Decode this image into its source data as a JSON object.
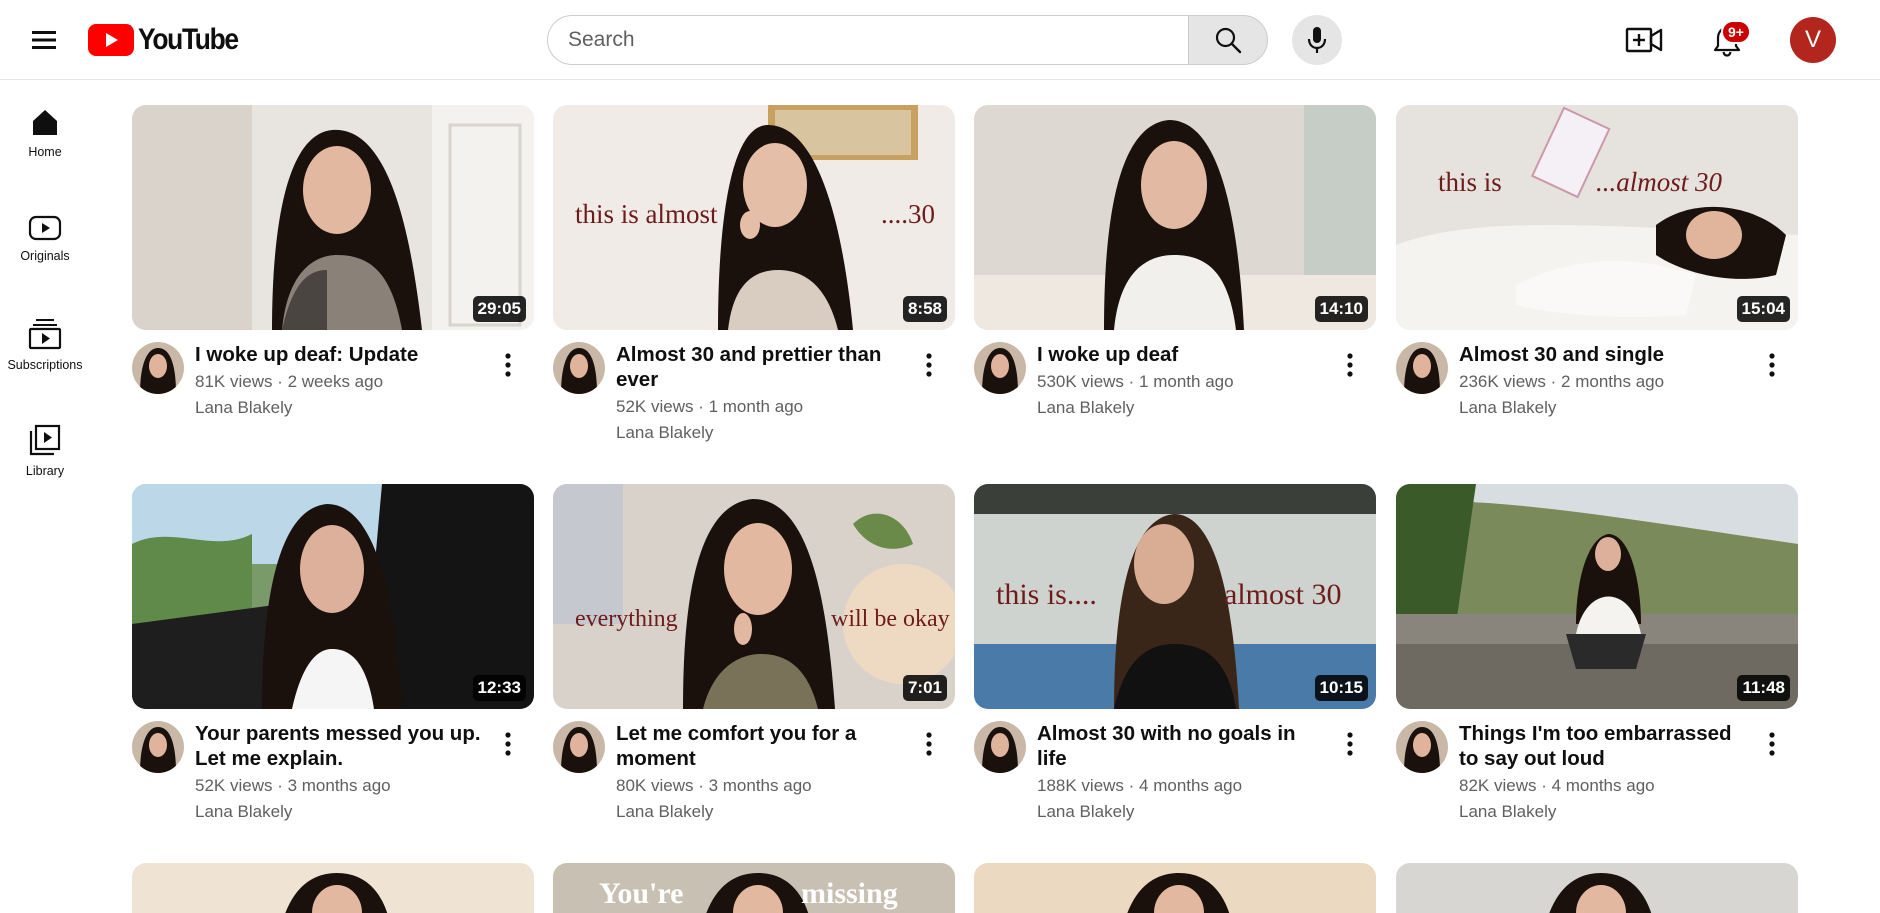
{
  "header": {
    "logo_text": "YouTube",
    "search_placeholder": "Search",
    "notification_count": "9+",
    "account_initial": "V"
  },
  "sidebar": {
    "items": [
      {
        "label": "Home",
        "icon": "home-icon"
      },
      {
        "label": "Originals",
        "icon": "originals-icon"
      },
      {
        "label": "Subscriptions",
        "icon": "subscriptions-icon"
      },
      {
        "label": "Library",
        "icon": "library-icon"
      }
    ]
  },
  "videos": [
    {
      "title": "I woke up deaf: Update",
      "stats": "81K views · 2 weeks ago",
      "channel": "Lana Blakely",
      "duration": "29:05",
      "overlay": ""
    },
    {
      "title": "Almost 30 and prettier than ever",
      "stats": "52K views · 1 month ago",
      "channel": "Lana Blakely",
      "duration": "8:58",
      "overlay_left": "this is almost",
      "overlay_right": "....30"
    },
    {
      "title": "I woke up deaf",
      "stats": "530K views · 1 month ago",
      "channel": "Lana Blakely",
      "duration": "14:10",
      "overlay": ""
    },
    {
      "title": "Almost 30 and single",
      "stats": "236K views · 2 months ago",
      "channel": "Lana Blakely",
      "duration": "15:04",
      "overlay_left": "this is",
      "overlay_right": "...almost 30"
    },
    {
      "title": "Your parents messed you up. Let me explain.",
      "stats": "52K views · 3 months ago",
      "channel": "Lana Blakely",
      "duration": "12:33",
      "overlay": ""
    },
    {
      "title": "Let me comfort you for a moment",
      "stats": "80K views · 3 months ago",
      "channel": "Lana Blakely",
      "duration": "7:01",
      "overlay_left": "everything",
      "overlay_right": "will be okay"
    },
    {
      "title": "Almost 30 with no goals in life",
      "stats": "188K views · 4 months ago",
      "channel": "Lana Blakely",
      "duration": "10:15",
      "overlay_left": "this is....",
      "overlay_right": "almost 30"
    },
    {
      "title": "Things I'm too embarrassed to say out loud",
      "stats": "82K views · 4 months ago",
      "channel": "Lana Blakely",
      "duration": "11:48",
      "overlay": ""
    }
  ],
  "partial_row": {
    "overlay_left": "You're",
    "overlay_right": "missing"
  }
}
